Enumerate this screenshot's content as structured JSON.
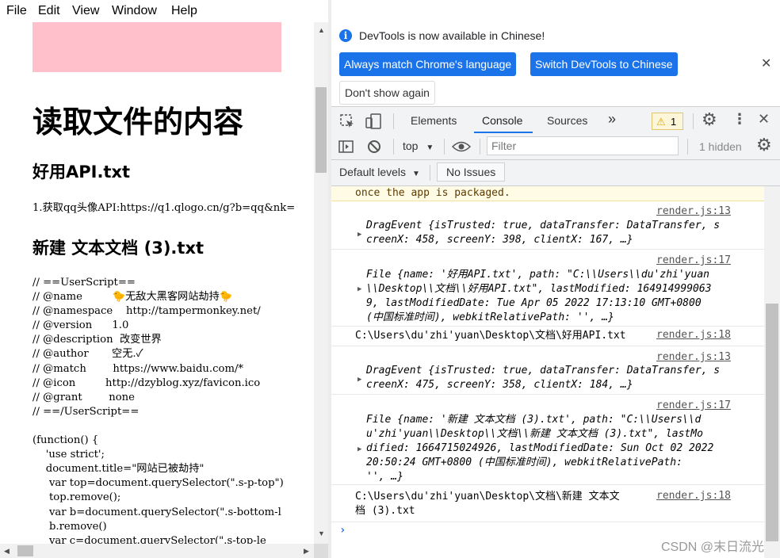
{
  "menu": [
    "File",
    "Edit",
    "View",
    "Window",
    "Help"
  ],
  "page": {
    "title": "读取文件的内容",
    "section1_title": "好用API.txt",
    "section1_text": "1.获取qq头像API:https://q1.qlogo.cn/g?b=qq&nk=",
    "section2_title": "新建 文本文档 (3).txt",
    "script_lines": [
      "// ==UserScript==",
      "// @name         🐤无敌大黑客网站劫持🐤",
      "// @namespace    http://tampermonkey.net/",
      "// @version      1.0",
      "// @description  改变世界",
      "// @author       空无.✓",
      "// @match        https://www.baidu.com/*",
      "// @icon         http://dzyblog.xyz/favicon.ico",
      "// @grant        none",
      "// ==/UserScript==",
      "",
      "(function() {",
      "    'use strict';",
      "    document.title=\"网站已被劫持\"",
      "     var top=document.querySelector(\".s-p-top\")",
      "     top.remove();",
      "     var b=document.querySelector(\".s-bottom-l",
      "     b.remove()",
      "     var c=document.querySelector(\".s-top-le"
    ]
  },
  "devtools": {
    "info_text": "DevTools is now available in Chinese!",
    "btn_match": "Always match Chrome's language",
    "btn_switch": "Switch DevTools to Chinese",
    "btn_dont_show": "Don't show again",
    "tabs": [
      "Elements",
      "Console",
      "Sources"
    ],
    "active_tab": "Console",
    "warning_count": "1",
    "context": "top",
    "filter_placeholder": "Filter",
    "hidden_count": "1 hidden",
    "levels": "Default levels",
    "issues": "No Issues",
    "messages": {
      "m0": "once the app is packaged.",
      "m1_src": "render.js:13",
      "m1_l1": "DragEvent {isTrusted: true, dataTransfer: DataTransfer, s",
      "m1_l2": "creenX: 458, screenY: 398, clientX: 167, …}",
      "m2_src": "render.js:17",
      "m2_l1": "File {name: '好用API.txt', path: \"C:\\\\Users\\\\du'zhi'yuan",
      "m2_l2": "\\\\Desktop\\\\文档\\\\好用API.txt\", lastModified: 164914999063",
      "m2_l3": "9, lastModifiedDate: Tue Apr 05 2022 17:13:10 GMT+0800",
      "m2_l4": "(中国标准时间), webkitRelativePath: '', …}",
      "m3_text": "C:\\Users\\du'zhi'yuan\\Desktop\\文档\\好用API.txt",
      "m3_src": "render.js:18",
      "m4_src": "render.js:13",
      "m4_l1": "DragEvent {isTrusted: true, dataTransfer: DataTransfer, s",
      "m4_l2": "creenX: 475, screenY: 358, clientX: 184, …}",
      "m5_src": "render.js:17",
      "m5_l1": "File {name: '新建 文本文档 (3).txt', path: \"C:\\\\Users\\\\d",
      "m5_l2": "u'zhi'yuan\\\\Desktop\\\\文档\\\\新建 文本文档 (3).txt\", lastMo",
      "m5_l3": "dified: 1664715024926, lastModifiedDate: Sun Oct 02 2022",
      "m5_l4": "20:50:24 GMT+0800 (中国标准时间), webkitRelativePath:",
      "m5_l5": "'', …}",
      "m6_l1": "C:\\Users\\du'zhi'yuan\\Desktop\\文档\\新建 文本文",
      "m6_l2": "档 (3).txt",
      "m6_src": "render.js:18"
    }
  },
  "watermark": "CSDN @末日流光"
}
